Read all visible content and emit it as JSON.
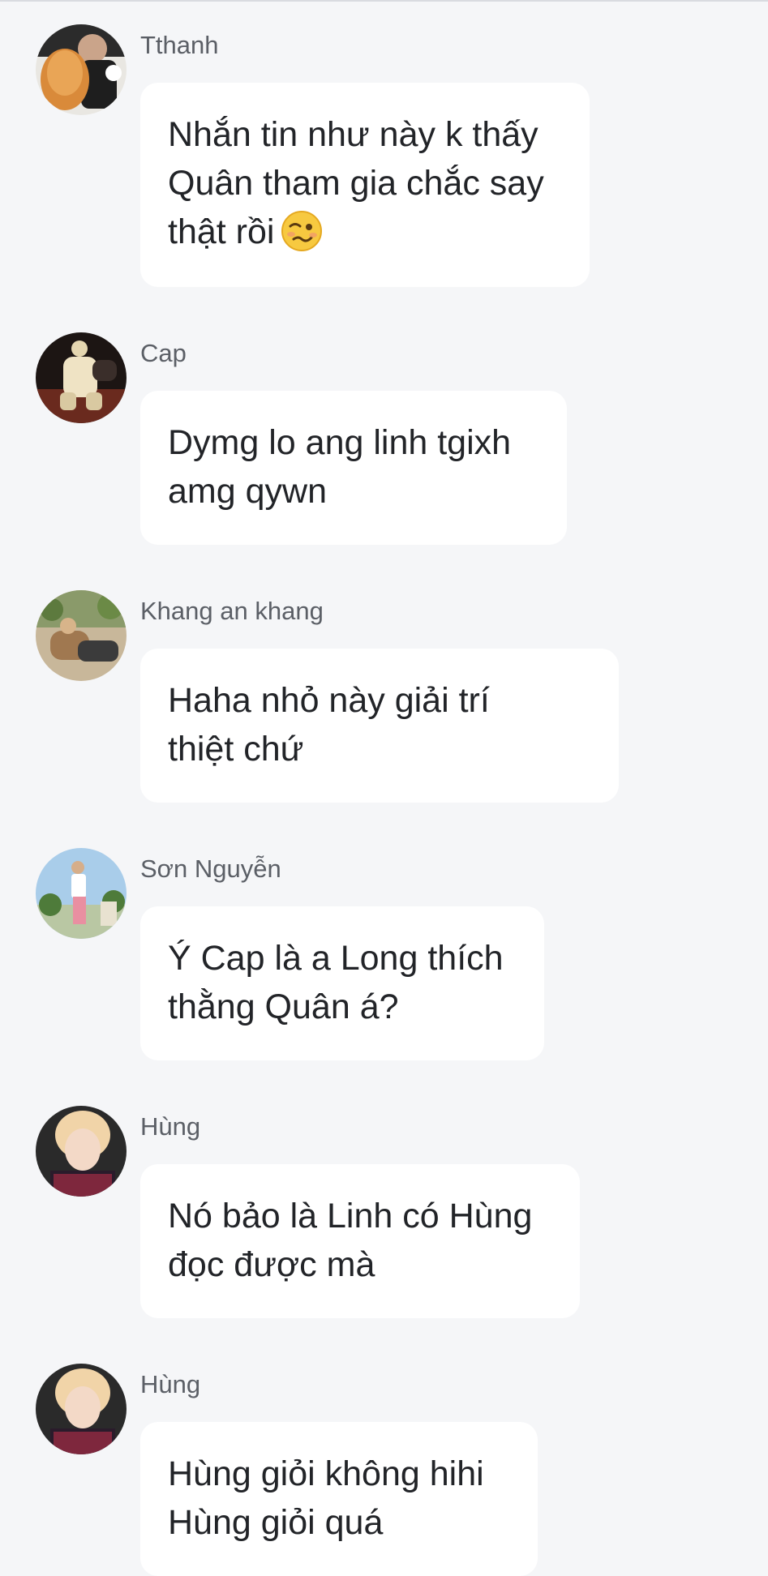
{
  "messages": [
    {
      "sender": "Tthanh",
      "lines": [
        "Nhắn tin như này k thấy",
        "Quân tham gia chắc say",
        "thật rồi"
      ],
      "emoji": "woozy-face-icon"
    },
    {
      "sender": "Cap",
      "lines": [
        "Dymg lo ang linh tgixh",
        "amg qywn"
      ]
    },
    {
      "sender": "Khang an khang",
      "lines": [
        "Haha nhỏ này giải trí",
        "thiệt chứ"
      ]
    },
    {
      "sender": "Sơn Nguyễn",
      "lines": [
        "Ý Cap là a Long thích",
        "thằng Quân á?"
      ]
    },
    {
      "sender": "Hùng",
      "lines": [
        "Nó bảo là Linh có Hùng",
        "đọc được mà"
      ]
    },
    {
      "sender": "Hùng",
      "lines": [
        "Hùng giỏi không hihi",
        "Hùng giỏi quá"
      ]
    }
  ],
  "colors": {
    "background": "#f5f6f8",
    "bubble": "#ffffff",
    "sender_text": "#5b5f66",
    "message_text": "#222428"
  }
}
